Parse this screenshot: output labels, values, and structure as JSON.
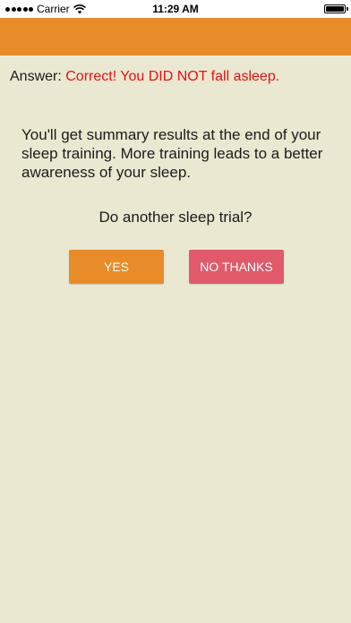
{
  "status_bar": {
    "carrier": "Carrier",
    "time": "11:29 AM",
    "icons": [
      "signal-icon",
      "wifi-icon",
      "battery-icon"
    ]
  },
  "colors": {
    "nav_bar": "#e88c29",
    "background": "#ebe8d2",
    "answer_value": "#e81010",
    "yes_button": "#e88c29",
    "no_button": "#e05a6b"
  },
  "result": {
    "label": "Answer:",
    "value": "Correct! You DID NOT fall asleep."
  },
  "summary": "You'll get summary results at the end of your sleep training. More training leads to a better awareness of your sleep.",
  "question": "Do another sleep trial?",
  "buttons": {
    "yes": "YES",
    "no": "NO THANKS"
  }
}
